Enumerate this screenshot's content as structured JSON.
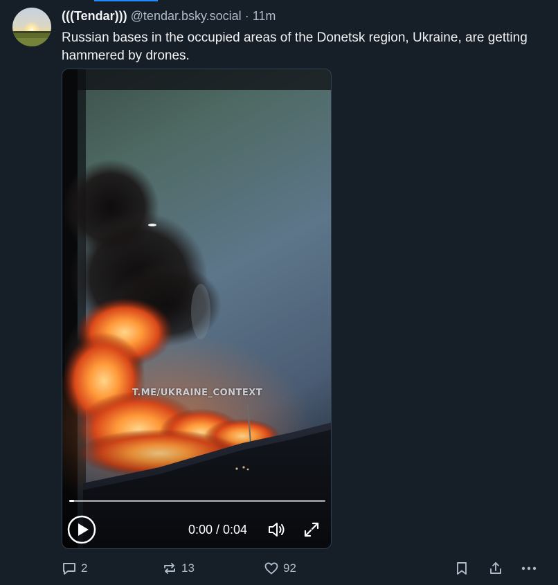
{
  "post": {
    "author": {
      "display_name": "(((Tendar)))",
      "handle": "@tendar.bsky.social"
    },
    "separator": "·",
    "timestamp": "11m",
    "text": "Russian bases in the occupied areas of the Donetsk region, Ukraine, are getting hammered by drones.",
    "media": {
      "watermark": "T.ME/UKRAINE_CONTEXT",
      "time_display": "0:00 / 0:04",
      "progress": 0.02
    },
    "actions": {
      "replies": "2",
      "reposts": "13",
      "likes": "92"
    }
  },
  "icons": {
    "reply": "speech-bubble-icon",
    "repost": "repost-arrows-icon",
    "like": "heart-icon",
    "bookmark": "bookmark-icon",
    "share": "share-upload-icon",
    "more": "more-dots-icon",
    "play": "play-circle-icon",
    "mute": "speaker-icon",
    "fullscreen": "fullscreen-arrows-icon"
  },
  "colors": {
    "background": "#161e27",
    "text_primary": "#f1f3f5",
    "text_secondary": "#aebbc9",
    "accent": "#208bfe"
  }
}
